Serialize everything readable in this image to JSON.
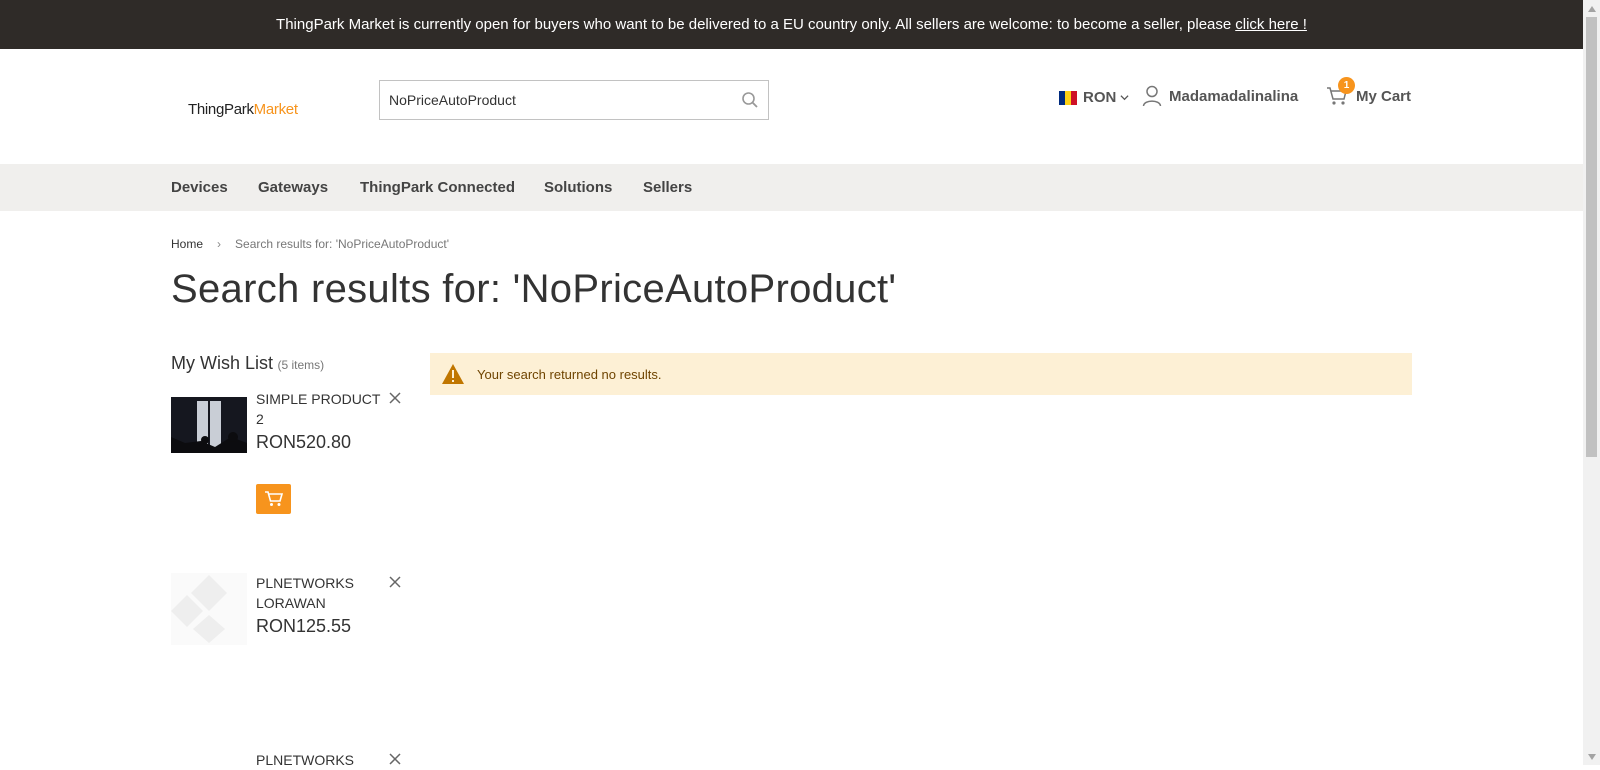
{
  "promo": {
    "text": "ThingPark Market is currently open for buyers who want to be delivered to a EU country only. All sellers are welcome: to become a seller, please",
    "link": "click here !"
  },
  "header": {
    "logo_part1": "ThingPark",
    "logo_part2": "Market",
    "search_value": "NoPriceAutoProduct",
    "currency": "RON",
    "account_name": "Madamadalinalina",
    "cart_count": "1",
    "cart_label": "My Cart"
  },
  "nav": {
    "items": [
      "Devices",
      "Gateways",
      "ThingPark Connected",
      "Solutions",
      "Sellers"
    ]
  },
  "breadcrumb": {
    "home": "Home",
    "current": "Search results for: 'NoPriceAutoProduct'"
  },
  "page_title": "Search results for: 'NoPriceAutoProduct'",
  "wishlist": {
    "title": "My Wish List",
    "count": "(5 items)",
    "items": [
      {
        "name": "SIMPLE PRODUCT 2",
        "price": "RON520.80"
      },
      {
        "name": "PLNETWORKS LORAWAN",
        "price": "RON125.55"
      },
      {
        "name": "PLNETWORKS"
      }
    ]
  },
  "notice": {
    "message": "Your search returned no results."
  },
  "colors": {
    "accent": "#f7941d",
    "promo_bg": "#2f2b28",
    "nav_bg": "#f0efed",
    "notice_bg": "#fdf0d5"
  }
}
